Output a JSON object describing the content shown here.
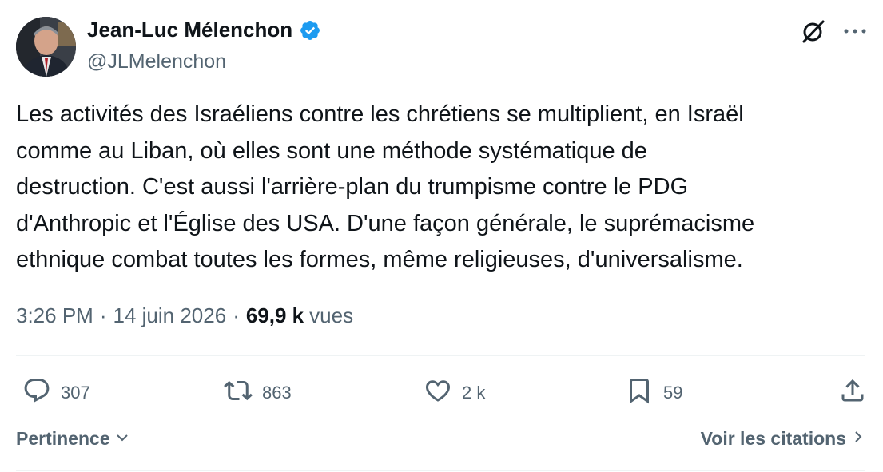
{
  "author": {
    "name": "Jean-Luc Mélenchon",
    "handle": "@JLMelenchon",
    "verified_icon": "verified-badge-icon",
    "badge_color": "#1d9bf0"
  },
  "tweet": {
    "text": "Les activités des Israéliens contre les chrétiens se multiplient, en Israël\ncomme au Liban, où elles sont une méthode systématique de\ndestruction. C'est aussi l'arrière-plan du trumpisme contre le PDG\nd'Anthropic et l'Église des USA. D'une façon générale, le suprémacisme\nethnique combat toutes les formes, même religieuses, d'universalisme."
  },
  "meta": {
    "time": "3:26 PM",
    "date": "14 juin 2026",
    "separator": "·",
    "views_count": "69,9 k",
    "views_label": "vues"
  },
  "actions": {
    "replies": "307",
    "reposts": "863",
    "likes": "2 k",
    "bookmarks": "59"
  },
  "footer": {
    "sort_label": "Pertinence",
    "quotes_label": "Voir les citations"
  },
  "icons": {
    "grok": "grok-icon",
    "more": "more-icon",
    "reply": "reply-icon",
    "repost": "repost-icon",
    "like": "heart-icon",
    "bookmark": "bookmark-icon",
    "share": "share-icon"
  },
  "colors": {
    "text": "#0f1419",
    "secondary": "#536471",
    "divider": "#eff3f4"
  }
}
